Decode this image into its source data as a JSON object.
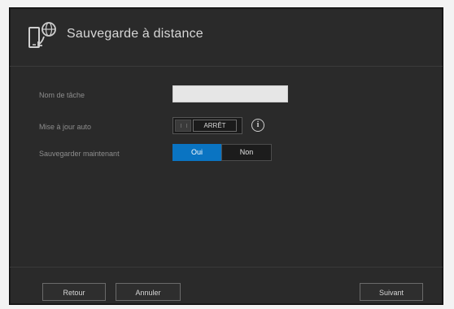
{
  "header": {
    "title": "Sauvegarde à distance",
    "icon": "phone-globe-icon"
  },
  "form": {
    "task_name_label": "Nom de tâche",
    "task_name_value": "",
    "auto_update_label": "Mise à jour auto",
    "auto_update_toggle_text": "ARRÊT",
    "backup_now_label": "Sauvegarder maintenant",
    "backup_now_yes": "Oui",
    "backup_now_no": "Non"
  },
  "footer": {
    "back_label": "Retour",
    "cancel_label": "Annuler",
    "next_label": "Suivant"
  },
  "colors": {
    "accent": "#0a74c2",
    "panel": "#2a2a2a"
  }
}
